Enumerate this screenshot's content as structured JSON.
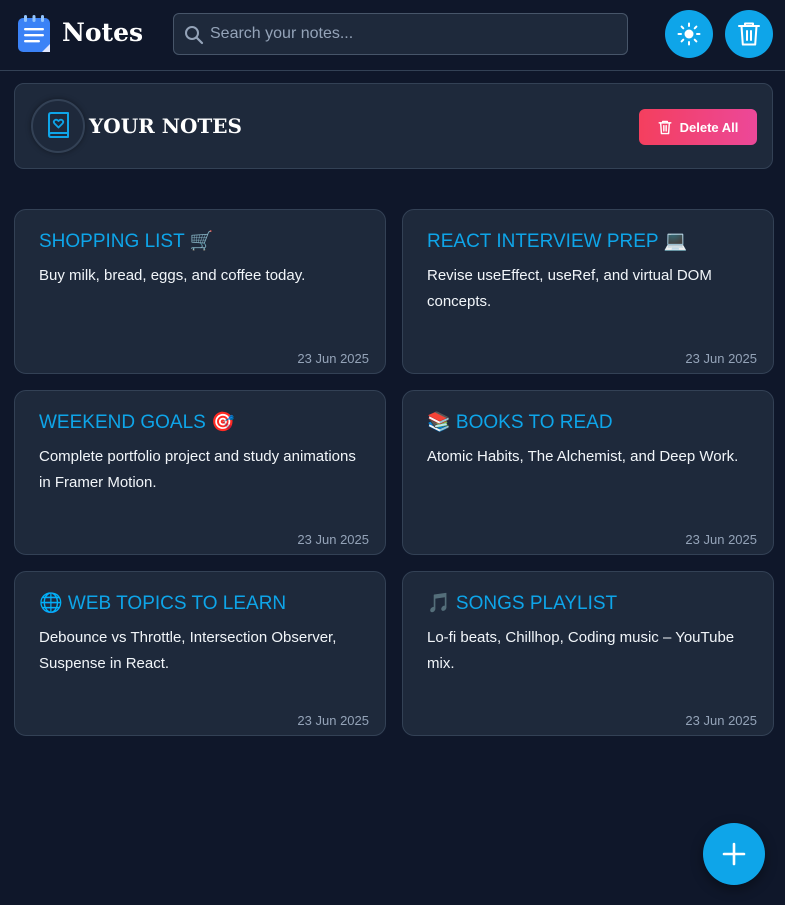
{
  "header": {
    "app_title": "Notes",
    "logo_icon": "notepad-icon",
    "search_placeholder": "Search your notes...",
    "search_value": "",
    "theme_icon": "sun-icon",
    "trash_icon": "trash-icon"
  },
  "panel": {
    "icon": "book-heart-icon",
    "title": "YOUR NOTES",
    "delete_all_label": "Delete All"
  },
  "notes": [
    {
      "title": "SHOPPING LIST 🛒",
      "body": "Buy milk, bread, eggs, and coffee today.",
      "date": "23 Jun 2025"
    },
    {
      "title": "REACT INTERVIEW PREP 💻",
      "body": "Revise useEffect, useRef, and virtual DOM concepts.",
      "date": "23 Jun 2025"
    },
    {
      "title": "WEEKEND GOALS 🎯",
      "body": "Complete portfolio project and study animations in Framer Motion.",
      "date": "23 Jun 2025"
    },
    {
      "title": "📚 BOOKS TO READ",
      "body": "Atomic Habits, The Alchemist, and Deep Work.",
      "date": "23 Jun 2025"
    },
    {
      "title": "🌐 WEB TOPICS TO LEARN",
      "body": "Debounce vs Throttle, Intersection Observer, Suspense in React.",
      "date": "23 Jun 2025"
    },
    {
      "title": "🎵 SONGS PLAYLIST",
      "body": "Lo-fi beats, Chillhop, Coding music – YouTube mix.",
      "date": "23 Jun 2025"
    }
  ],
  "fab_icon": "plus-icon",
  "colors": {
    "background": "#0f172a",
    "card": "#1e293b",
    "accent": "#0ea5e9",
    "danger_gradient_start": "#f43f5e",
    "danger_gradient_end": "#ec4899"
  }
}
